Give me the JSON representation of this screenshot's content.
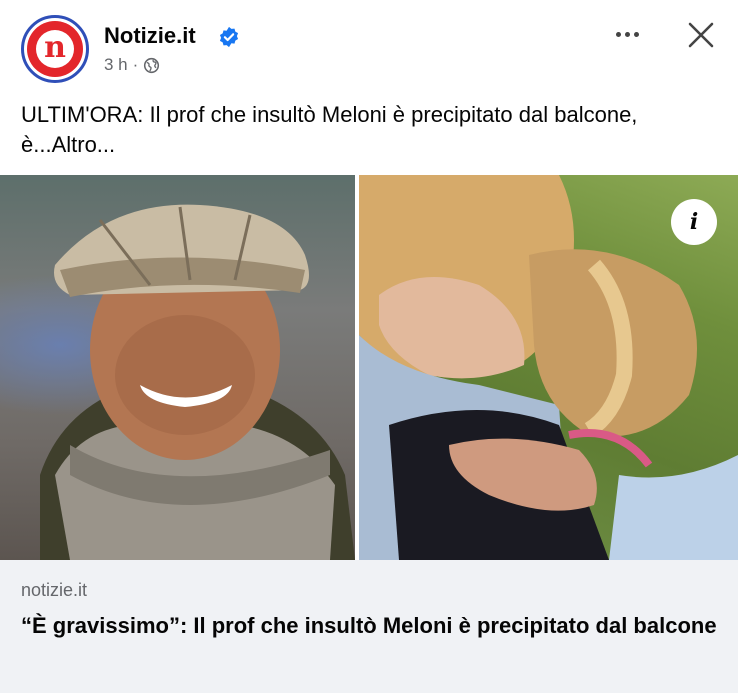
{
  "header": {
    "page_name": "Notizie.it",
    "avatar_letter": "n",
    "time": "3 h",
    "separator": "·",
    "icons": {
      "verified": "verified-badge-icon",
      "audience": "globe-icon",
      "more": "more-options-icon",
      "close": "close-icon"
    },
    "colors": {
      "verified": "#1877f2",
      "brand_red": "#e3262b",
      "brand_ring": "#2f4fb8"
    }
  },
  "post": {
    "text": "ULTIM'ORA: Il prof che insultò Meloni è precipitato dal balcone, è...Altro..."
  },
  "media": {
    "info_icon": "i"
  },
  "link_preview": {
    "domain": "notizie.it",
    "title": "“È gravissimo”: Il prof che insultò Meloni è precipitato dal balcone"
  }
}
